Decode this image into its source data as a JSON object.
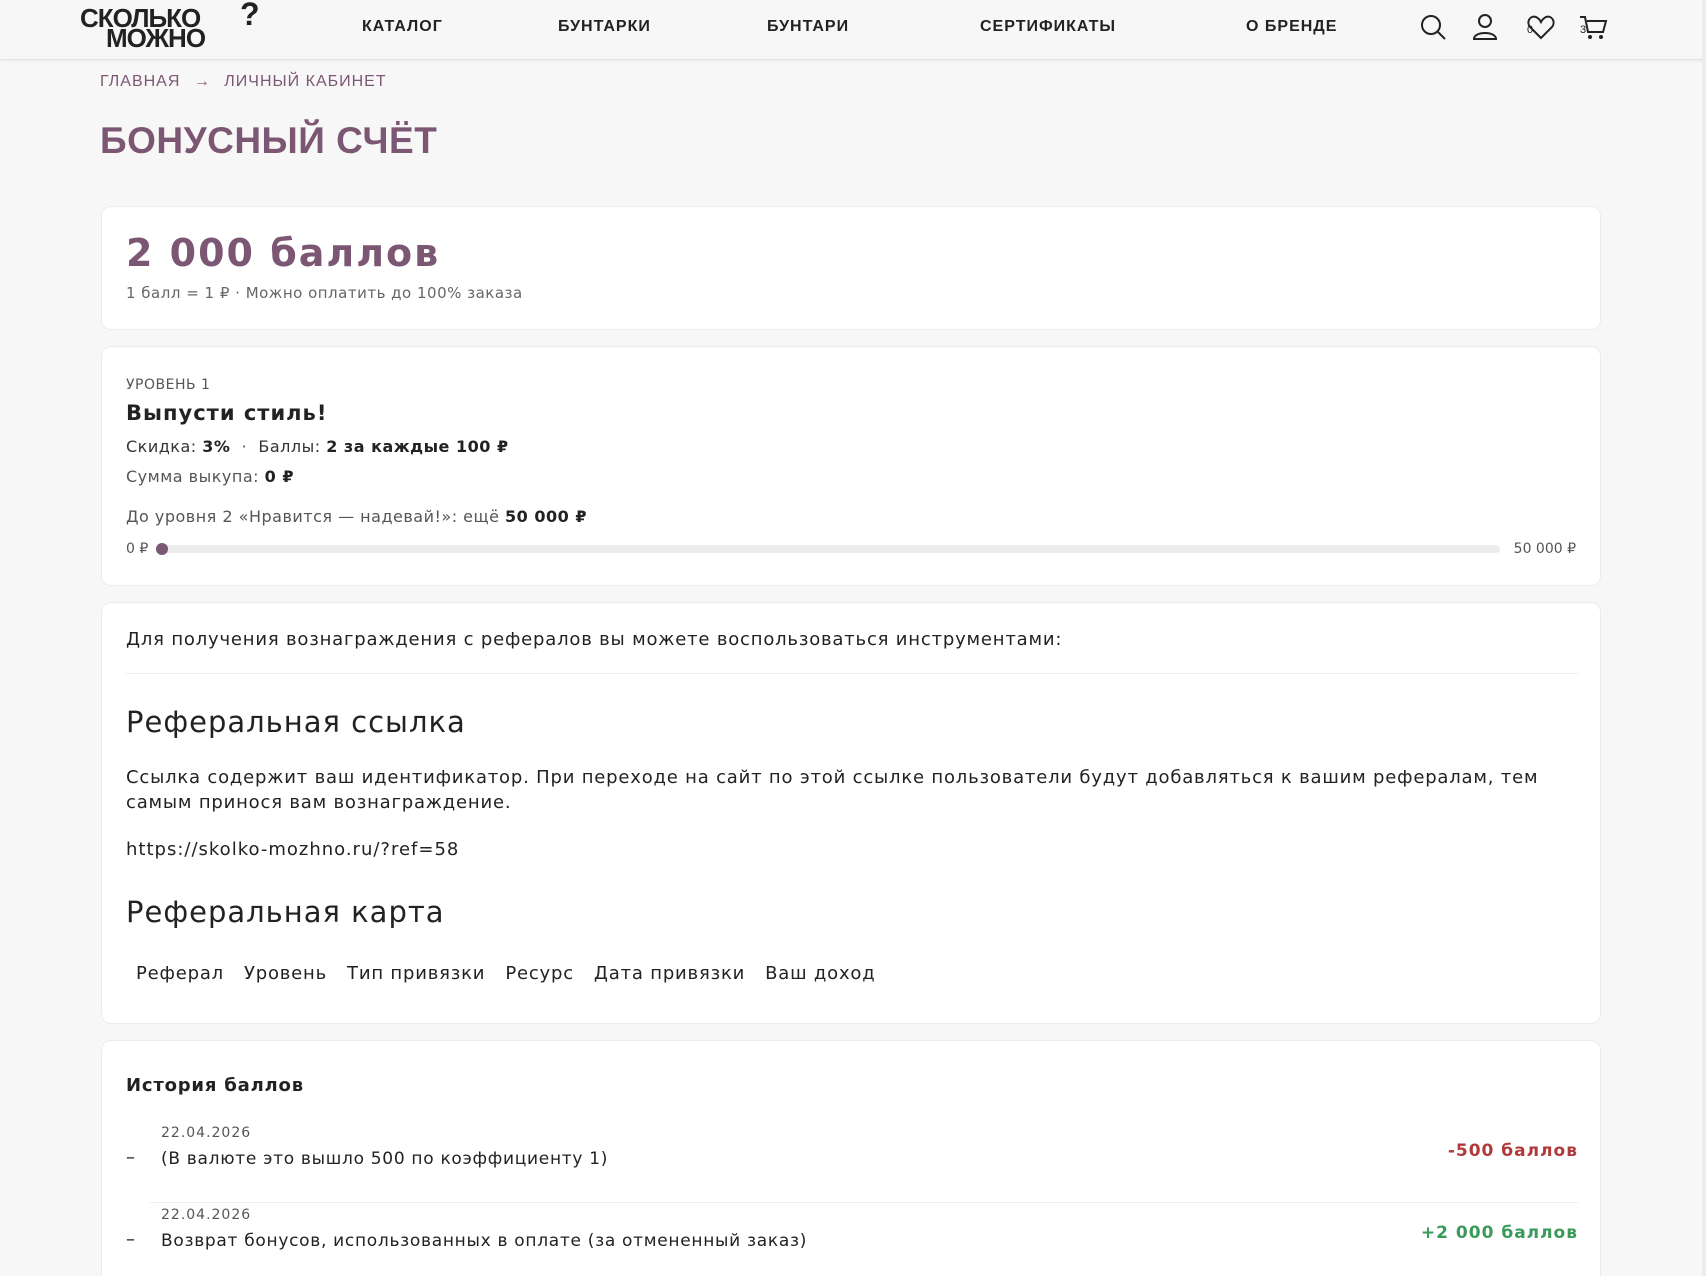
{
  "header": {
    "logo_line1": "СКОЛЬКО",
    "logo_line2": "МОЖНО",
    "logo_mark": "?",
    "nav": [
      "КАТАЛОГ",
      "БУНТАРКИ",
      "БУНТАРИ",
      "СЕРТИФИКАТЫ",
      "О БРЕНДЕ"
    ],
    "wishlist_count": "0",
    "cart_count": "3"
  },
  "breadcrumb": {
    "home": "ГЛАВНАЯ",
    "arrow": "→",
    "current": "ЛИЧНЫЙ КАБИНЕТ"
  },
  "page_title": "БОНУСНЫЙ СЧЁТ",
  "balance": {
    "value": "2 000 баллов",
    "note": "1 балл = 1 ₽ · Можно оплатить до 100% заказа"
  },
  "level": {
    "label": "УРОВЕНЬ 1",
    "name": "Выпусти стиль!",
    "discount_label": "Скидка:",
    "discount_value": "3%",
    "sep": "·",
    "points_label": "Баллы:",
    "points_value": "2 за каждые 100 ₽",
    "sum_label": "Сумма выкупа:",
    "sum_value": "0 ₽",
    "next_label": "До уровня 2 «Нравится — надевай!»: ещё",
    "next_value": "50 000 ₽",
    "progress_min": "0 ₽",
    "progress_max": "50 000 ₽",
    "progress_fraction": 0
  },
  "referral": {
    "intro": "Для получения вознаграждения с рефералов вы можете воспользоваться инструментами:",
    "link_title": "Реферальная ссылка",
    "link_desc": "Ссылка содержит ваш идентификатор. При переходе на сайт по этой ссылке пользователи будут добавляться к вашим рефералам, тем самым принося вам вознаграждение.",
    "link_url": "https://skolko-mozhno.ru/?ref=58",
    "map_title": "Реферальная карта",
    "columns": [
      "Реферал",
      "Уровень",
      "Тип привязки",
      "Ресурс",
      "Дата привязки",
      "Ваш доход"
    ]
  },
  "history": {
    "title": "История баллов",
    "rows": [
      {
        "dash": "–",
        "date": "22.04.2026",
        "desc": "(В валюте это вышло 500 по коэффициенту 1)",
        "amount": "-500 баллов",
        "color": "#b03a3a"
      },
      {
        "dash": "–",
        "date": "22.04.2026",
        "desc": "Возврат бонусов, использованных в оплате (за отмененный заказ)",
        "amount": "+2 000 баллов",
        "color": "#3a9a5a"
      }
    ]
  },
  "colors": {
    "accent": "#7c5773",
    "negative": "#b03a3a",
    "positive": "#3a9a5a"
  }
}
